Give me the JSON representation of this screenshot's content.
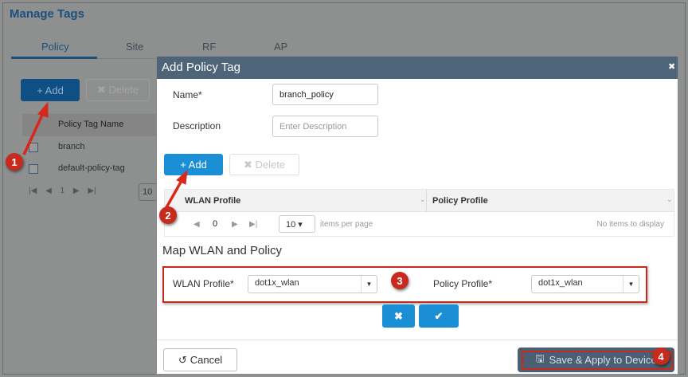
{
  "background": {
    "title": "Manage Tags",
    "tabs": [
      "Policy",
      "Site",
      "RF",
      "AP"
    ],
    "add_label": "+ Add",
    "delete_label": "✖ Delete",
    "column": "Policy Tag Name",
    "rows": [
      "branch",
      "default-policy-tag"
    ],
    "page": "1",
    "page_size": "10"
  },
  "dialog": {
    "title": "Add Policy Tag",
    "close": "✖",
    "name_label": "Name*",
    "name_value": "branch_policy",
    "desc_label": "Description",
    "desc_placeholder": "Enter Description",
    "add_label": "+ Add",
    "delete_label": "✖ Delete",
    "columns": [
      "WLAN Profile",
      "Policy Profile"
    ],
    "page": "0",
    "page_size": "10",
    "per_page": "items per page",
    "empty": "No items to display",
    "map_title": "Map WLAN and Policy",
    "wlan_label": "WLAN Profile*",
    "wlan_value": "dot1x_wlan",
    "policy_label": "Policy Profile*",
    "policy_value": "dot1x_wlan",
    "cancel_label": "Cancel",
    "save_label": "Save & Apply to Device"
  },
  "annotations": [
    "1",
    "2",
    "3",
    "4"
  ],
  "colors": {
    "header": "#4d6479",
    "primary": "#1a8fd6",
    "annotation": "#c62b1d"
  }
}
